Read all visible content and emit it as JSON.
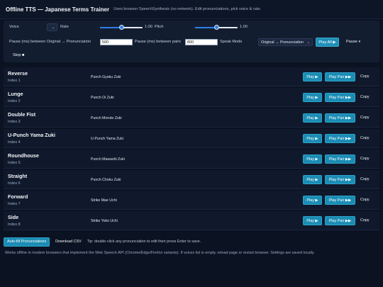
{
  "header": {
    "title": "Offline TTS — Japanese Terms Trainer",
    "subtitle": "Uses browser SpeechSynthesis (no network). Edit pronunciations, pick voice & rate."
  },
  "controls": {
    "voice_label": "Voice",
    "voice_value": "",
    "rate_label": "Rate",
    "rate_value": "1.00",
    "rate_fraction": 0.5,
    "pitch_label": "Pitch",
    "pitch_value": "1.00",
    "pitch_fraction": 0.5,
    "pause_between_label": "Pause (ms) between Original → Pronunciation",
    "pause_between_value": "500",
    "pause_pairs_label": "Pause (ms) between pairs",
    "pause_pairs_value": "800",
    "speak_mode_label": "Speak Mode",
    "speak_mode_value": "Original → Pronunciation",
    "play_all_label": "Play All ▶",
    "pause_label": "Pause ⏸",
    "stop_label": "Stop ■"
  },
  "terms": [
    {
      "name": "Reverse",
      "index": "Index 1",
      "pronunciation": "Punch Gyaku Zuki",
      "play": "Play ▶",
      "pair": "Play Pair ▶▶",
      "copy": "Copy"
    },
    {
      "name": "Lunge",
      "index": "Index 2",
      "pronunciation": "Punch Oi Zuki",
      "play": "Play ▶",
      "pair": "Play Pair ▶▶",
      "copy": "Copy"
    },
    {
      "name": "Double Fist",
      "index": "Index 3",
      "pronunciation": "Punch Morote Zuki",
      "play": "Play ▶",
      "pair": "Play Pair ▶▶",
      "copy": "Copy"
    },
    {
      "name": "U-Punch Yama Zuki",
      "index": "Index 4",
      "pronunciation": "U-Punch Yama Zuki",
      "play": "Play ▶",
      "pair": "Play Pair ▶▶",
      "copy": "Copy"
    },
    {
      "name": "Roundhouse",
      "index": "Index 5",
      "pronunciation": "Punch Mawashi Zuki",
      "play": "Play ▶",
      "pair": "Play Pair ▶▶",
      "copy": "Copy"
    },
    {
      "name": "Straight",
      "index": "Index 6",
      "pronunciation": "Punch Choku Zuki",
      "play": "Play ▶",
      "pair": "Play Pair ▶▶",
      "copy": "Copy"
    },
    {
      "name": "Forward",
      "index": "Index 7",
      "pronunciation": "Strike Mae Uchi",
      "play": "Play ▶",
      "pair": "Play Pair ▶▶",
      "copy": "Copy"
    },
    {
      "name": "Side",
      "index": "Index 8",
      "pronunciation": "Strike Yoko Uchi",
      "play": "Play ▶",
      "pair": "Play Pair ▶▶",
      "copy": "Copy"
    }
  ],
  "footer": {
    "autofill_label": "Auto-fill Pronunciations",
    "download_label": "Download CSV",
    "tip": "Tip: double-click any pronunciation to edit then press Enter to save.",
    "note": "Works offline in modern browsers that implement the Web Speech API (Chrome/Edge/Firefox variants). If voices list is empty, reload page or restart browser. Settings are saved locally."
  },
  "colors": {
    "background": "#0b1322",
    "accent": "#1b8db5",
    "slider": "#2f7fe6"
  }
}
